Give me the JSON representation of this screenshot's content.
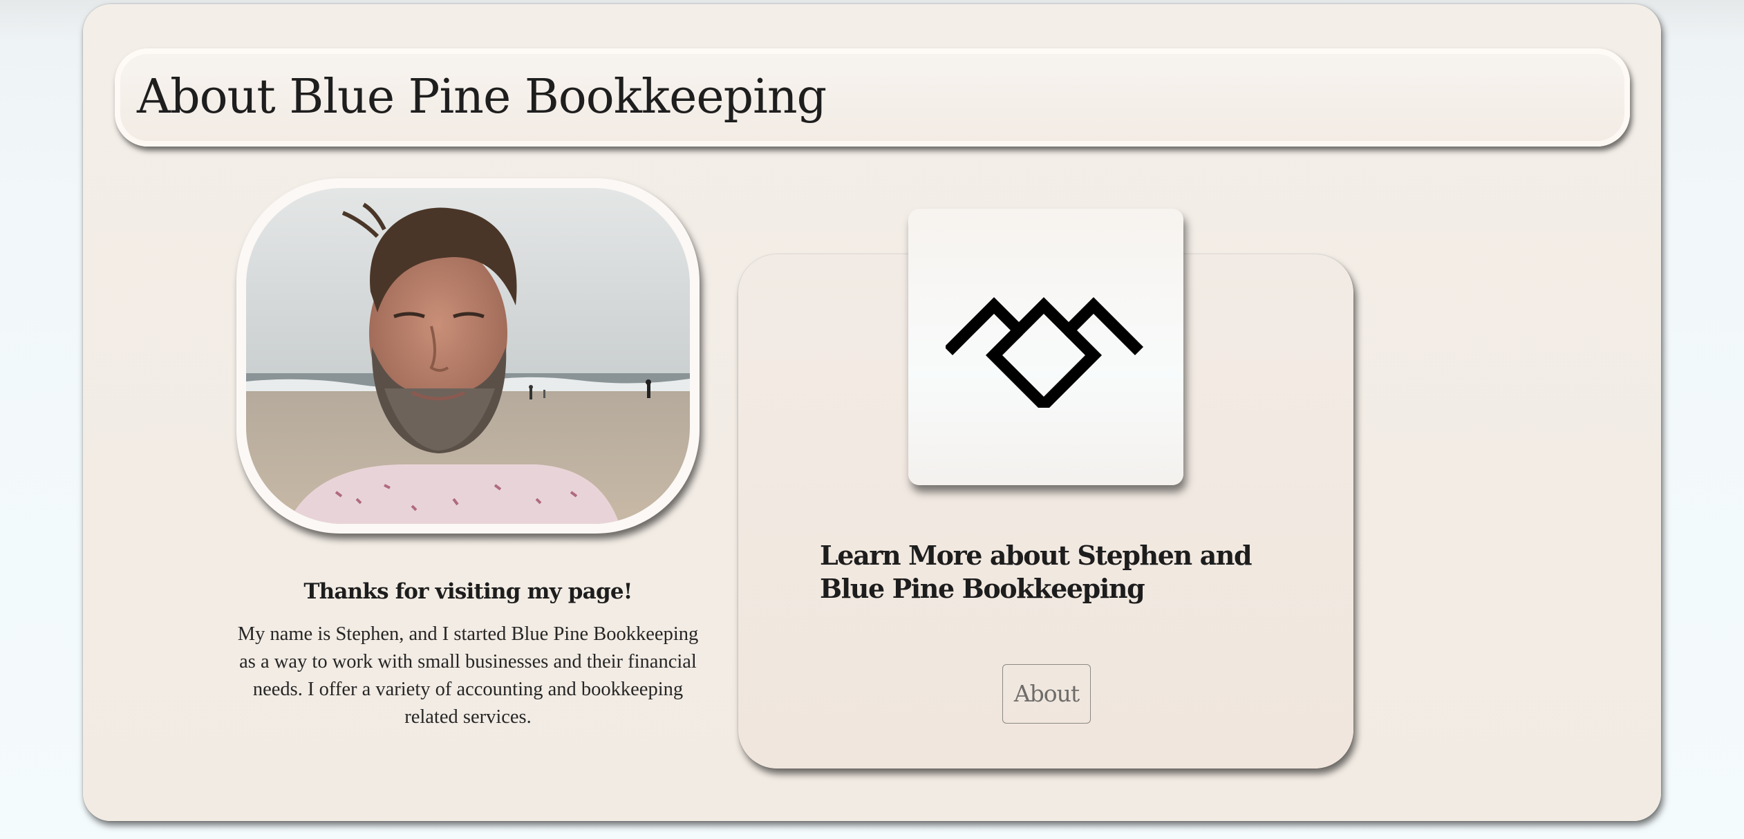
{
  "page": {
    "title": "About Blue Pine Bookkeeping"
  },
  "intro": {
    "photo_alt": "Photo of Stephen smiling on a beach",
    "heading": "Thanks for visiting my page!",
    "body": "My name is Stephen, and I started Blue Pine Bookkeeping as a way to work with small businesses and their financial needs. I offer a variety of accounting and bookkeeping related services."
  },
  "learn_more": {
    "logo_icon": "mountain-diamond-logo-icon",
    "heading": "Learn More about Stephen and Blue Pine Bookkeeping",
    "button_label": "About"
  },
  "colors": {
    "page_background": "#f4fbfd",
    "card_background": "#f3eee8",
    "text": "#1d1d1d",
    "button_text": "#6e6c6a"
  }
}
